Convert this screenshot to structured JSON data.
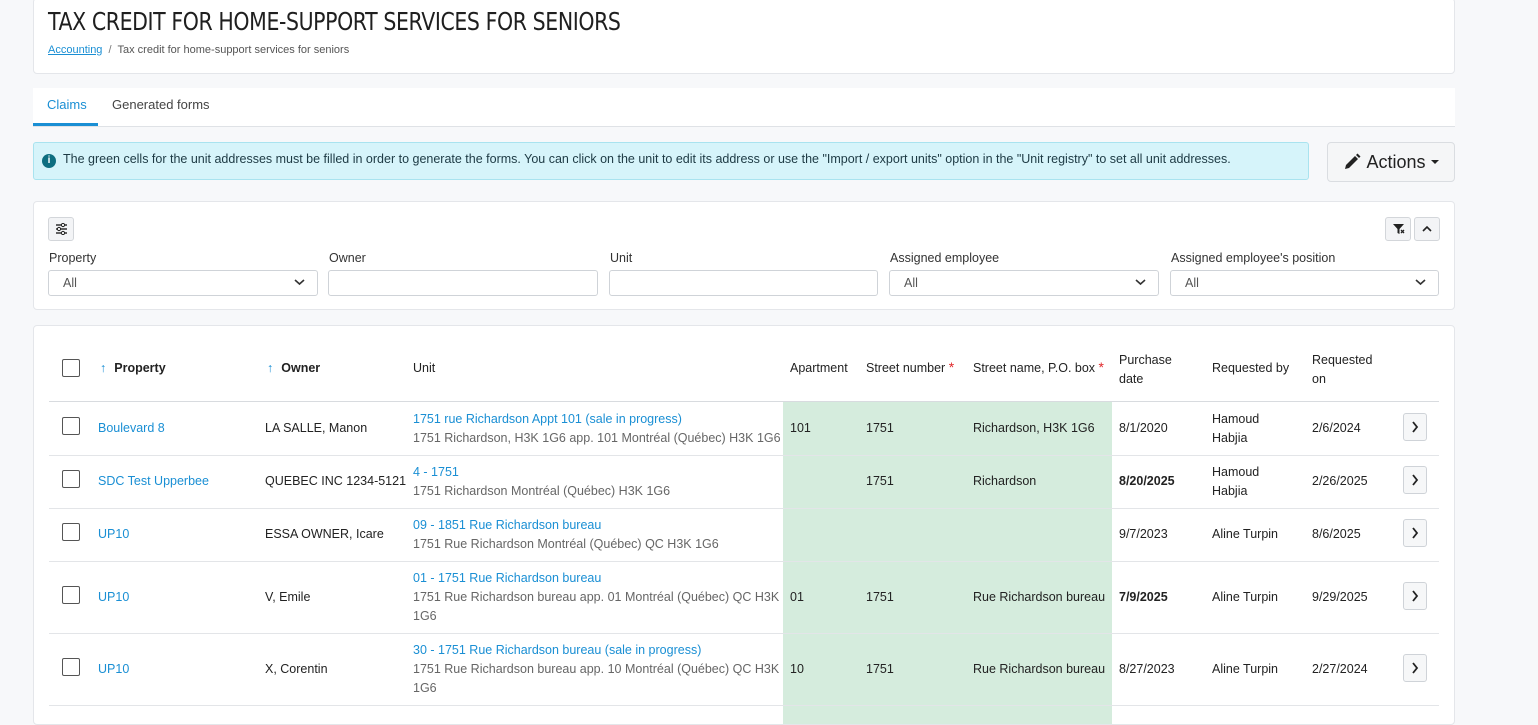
{
  "page": {
    "title": "TAX CREDIT FOR HOME-SUPPORT SERVICES FOR SENIORS",
    "breadcrumb_root": "Accounting",
    "breadcrumb_sep": "/",
    "breadcrumb_current": "Tax credit for home-support services for seniors"
  },
  "tabs": [
    {
      "label": "Claims",
      "active": true
    },
    {
      "label": "Generated forms",
      "active": false
    }
  ],
  "alert": {
    "icon": "info-icon",
    "text": "The green cells for the unit addresses must be filled in order to generate the forms. You can click on the unit to edit its address or use the \"Import / export units\" option in the \"Unit registry\" to set all unit addresses."
  },
  "actions": {
    "label": "Actions",
    "icon": "pencil-icon"
  },
  "filters": {
    "property": {
      "label": "Property",
      "value": "All"
    },
    "owner": {
      "label": "Owner",
      "value": ""
    },
    "unit": {
      "label": "Unit",
      "value": ""
    },
    "employee": {
      "label": "Assigned employee",
      "value": "All"
    },
    "position": {
      "label": "Assigned employee's position",
      "value": "All"
    }
  },
  "table": {
    "headers": {
      "property": "Property",
      "owner": "Owner",
      "unit": "Unit",
      "apartment": "Apartment",
      "street_number": "Street number",
      "street_name": "Street name, P.O. box",
      "purchase_date_1": "Purchase",
      "purchase_date_2": "date",
      "requested_by": "Requested by",
      "requested_on_1": "Requested",
      "requested_on_2": "on",
      "required_mark": "*",
      "sort_icon": "↑"
    },
    "rows": [
      {
        "property": "Boulevard 8",
        "owner": "LA SALLE, Manon",
        "unit_link": "1751 rue Richardson Appt 101 (sale in progress)",
        "unit_addr1": "1751 Richardson, H3K 1G6 app. 101 Montréal (Québec) H3K 1G6",
        "unit_addr2": "",
        "apartment": "101",
        "street_number": "1751",
        "street_name": "Richardson, H3K 1G6",
        "purchase_date": "8/1/2020",
        "requested_by_1": "Hamoud",
        "requested_by_2": "Habjia",
        "requested_on": "2/6/2024"
      },
      {
        "property": "SDC Test Upperbee",
        "owner": "QUEBEC INC 1234-5121",
        "unit_link": "4 - 1751",
        "unit_addr1": "1751 Richardson Montréal (Québec) H3K 1G6",
        "unit_addr2": "",
        "apartment": "",
        "street_number": "1751",
        "street_name": "Richardson",
        "purchase_date": "8/20/2025",
        "requested_by_1": "Hamoud",
        "requested_by_2": "Habjia",
        "requested_on": "2/26/2025"
      },
      {
        "property": "UP10",
        "owner": "ESSA OWNER, Icare",
        "unit_link": "09 - 1851 Rue Richardson bureau",
        "unit_addr1": "1751 Rue Richardson Montréal (Québec) QC H3K 1G6",
        "unit_addr2": "",
        "apartment": "",
        "street_number": "",
        "street_name": "",
        "purchase_date": "9/7/2023",
        "requested_by_1": "Aline Turpin",
        "requested_by_2": "",
        "requested_on": "8/6/2025"
      },
      {
        "property": "UP10",
        "owner": "V, Emile",
        "unit_link": "01 - 1751 Rue Richardson bureau",
        "unit_addr1": "1751 Rue Richardson bureau app. 01 Montréal (Québec) QC H3K",
        "unit_addr2": "1G6",
        "apartment": "01",
        "street_number": "1751",
        "street_name": "Rue Richardson bureau",
        "purchase_date": "7/9/2025",
        "requested_by_1": "Aline Turpin",
        "requested_by_2": "",
        "requested_on": "9/29/2025"
      },
      {
        "property": "UP10",
        "owner": "X, Corentin",
        "unit_link": "30 - 1751 Rue Richardson bureau (sale in progress)",
        "unit_addr1": "1751 Rue Richardson bureau app. 10 Montréal (Québec) QC H3K",
        "unit_addr2": "1G6",
        "apartment": "10",
        "street_number": "1751",
        "street_name": "Rue Richardson bureau",
        "purchase_date": "8/27/2023",
        "requested_by_1": "Aline Turpin",
        "requested_by_2": "",
        "requested_on": "2/27/2024"
      }
    ]
  }
}
